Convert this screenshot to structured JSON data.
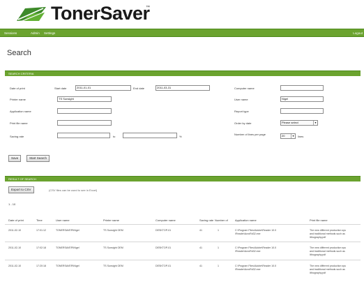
{
  "brand": {
    "name": "TonerSaver",
    "tm": "™",
    "accent": "#6ba32f"
  },
  "nav": {
    "items": [
      "Sessions",
      "Admin",
      "Settings"
    ],
    "right": "Logout"
  },
  "page": {
    "title": "Search"
  },
  "search": {
    "section_title": "SEARCH CRITERIA",
    "fields": {
      "date_of_print": {
        "label": "Date of print"
      },
      "start_date": {
        "label": "Start date",
        "value": "2011-01-01"
      },
      "end_date": {
        "label": "End date",
        "value": "2011-03-31"
      },
      "printer_name": {
        "label": "Printer name",
        "value": "TS Sunsight"
      },
      "application_name": {
        "label": "Application name",
        "value": ""
      },
      "print_file_name": {
        "label": "Print file name",
        "value": ""
      },
      "saving_rate": {
        "label": "Saving rate",
        "from": "",
        "to_label": "to",
        "to": "",
        "unit": "%"
      },
      "computer_name": {
        "label": "Computer name",
        "value": ""
      },
      "user_name": {
        "label": "User name",
        "value": "Nigel"
      },
      "report_type": {
        "label": "Report type",
        "value": ""
      },
      "order_by_date": {
        "label": "Order by date",
        "value": "Please select"
      },
      "rows_per_page": {
        "label": "Number of lines per page",
        "value": "20",
        "unit": "lines"
      }
    },
    "buttons": {
      "save": "Save",
      "start_search": "Start Search"
    }
  },
  "results": {
    "section_title": "RESULT OF SEARCH",
    "export_label": "Export to CSV",
    "export_note": "(CSV files can be used to see in Excel)",
    "count": "1 - 10",
    "columns": [
      "Date of print",
      "Time",
      "User name",
      "Printer name",
      "Computer name",
      "Saving rate",
      "Number of",
      "Application name",
      "Print file name"
    ],
    "rows": [
      {
        "date": "2011-02-10",
        "time": "17:01:12",
        "user": "TONERSAVER\\Nigel",
        "printer": "TS Sunsight OEM",
        "computer": "DESKTOP-01",
        "saving": "41",
        "number": "1",
        "app": [
          "C:\\Program Files\\Adobe\\Reader 10.0",
          "\\Reader\\AcroRd32.exe"
        ],
        "file": [
          "The new different production sys",
          "and traditional methods such as",
          "lithography.pdf"
        ]
      },
      {
        "date": "2011-02-10",
        "time": "17:02:18",
        "user": "TONERSAVER\\Nigel",
        "printer": "TS Sunsight OEM",
        "computer": "DESKTOP-01",
        "saving": "41",
        "number": "1",
        "app": [
          "C:\\Program Files\\Adobe\\Reader 10.0",
          "\\Reader\\AcroRd32.exe"
        ],
        "file": [
          "The new different production sys",
          "and traditional methods such as",
          "lithography.pdf"
        ]
      },
      {
        "date": "2011-02-10",
        "time": "17:20:18",
        "user": "TONERSAVER\\Nigel",
        "printer": "TS Sunsight OEM",
        "computer": "DESKTOP-01",
        "saving": "41",
        "number": "1",
        "app": [
          "C:\\Program Files\\Adobe\\Reader 10.0",
          "\\Reader\\AcroRd32.exe"
        ],
        "file": [
          "The new different production sys",
          "and traditional methods such as",
          "lithography.pdf"
        ]
      }
    ]
  }
}
